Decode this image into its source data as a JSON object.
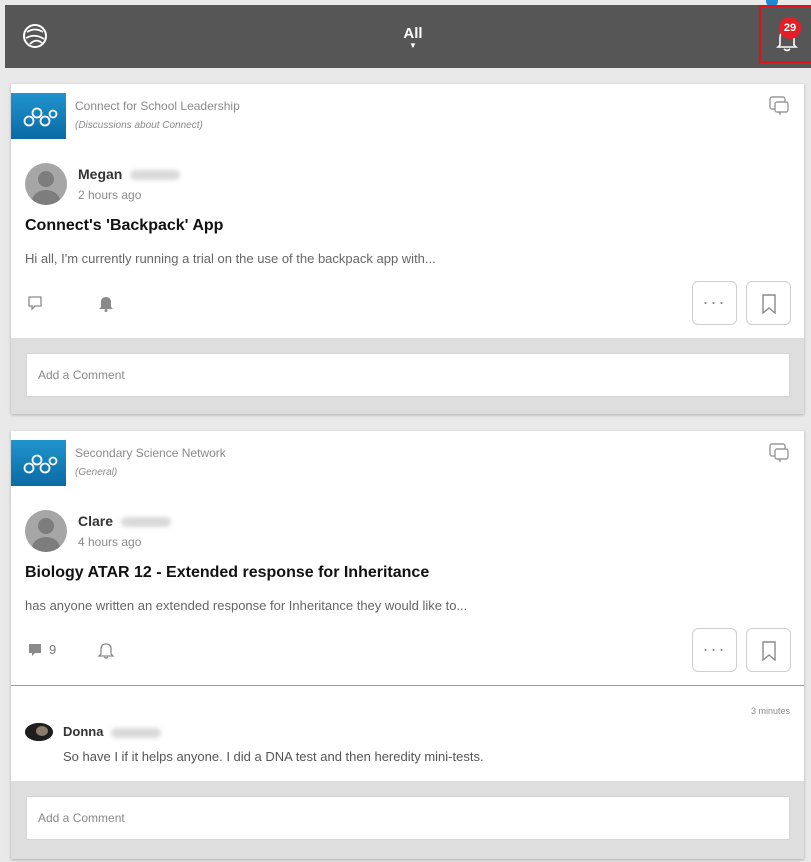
{
  "header": {
    "filter_label": "All",
    "notification_count": "29"
  },
  "posts": [
    {
      "group_name": "Connect for School Leadership",
      "group_category": "(Discussions about Connect)",
      "author_first_name": "Megan",
      "time": "2 hours ago",
      "title": "Connect's 'Backpack' App",
      "excerpt": "Hi all, I'm currently running a trial on the use of the backpack app with...",
      "comment_placeholder": "Add a Comment"
    },
    {
      "group_name": "Secondary Science Network",
      "group_category": "(General)",
      "author_first_name": "Clare",
      "time": "4 hours ago",
      "title": "Biology ATAR 12 - Extended response for Inheritance",
      "excerpt": "has anyone written an extended response for Inheritance they would like to...",
      "reply_count": "9",
      "latest_reply": {
        "author_first_name": "Donna",
        "time": "3 minutes",
        "text": "So have I if it helps anyone. I did a DNA test and then heredity mini-tests."
      },
      "comment_placeholder": "Add a Comment"
    }
  ],
  "icons": {
    "app_logo": "app-logo-icon",
    "bell": "bell-icon",
    "group": "molecule-icon",
    "chat": "chat-bubble-icon",
    "reply": "comment-icon",
    "more": "more-icon",
    "bookmark": "bookmark-icon"
  },
  "colors": {
    "header_bg": "#565656",
    "badge": "#e41e26",
    "highlight_border": "#e0141a",
    "group_icon": "#1a83c0"
  }
}
